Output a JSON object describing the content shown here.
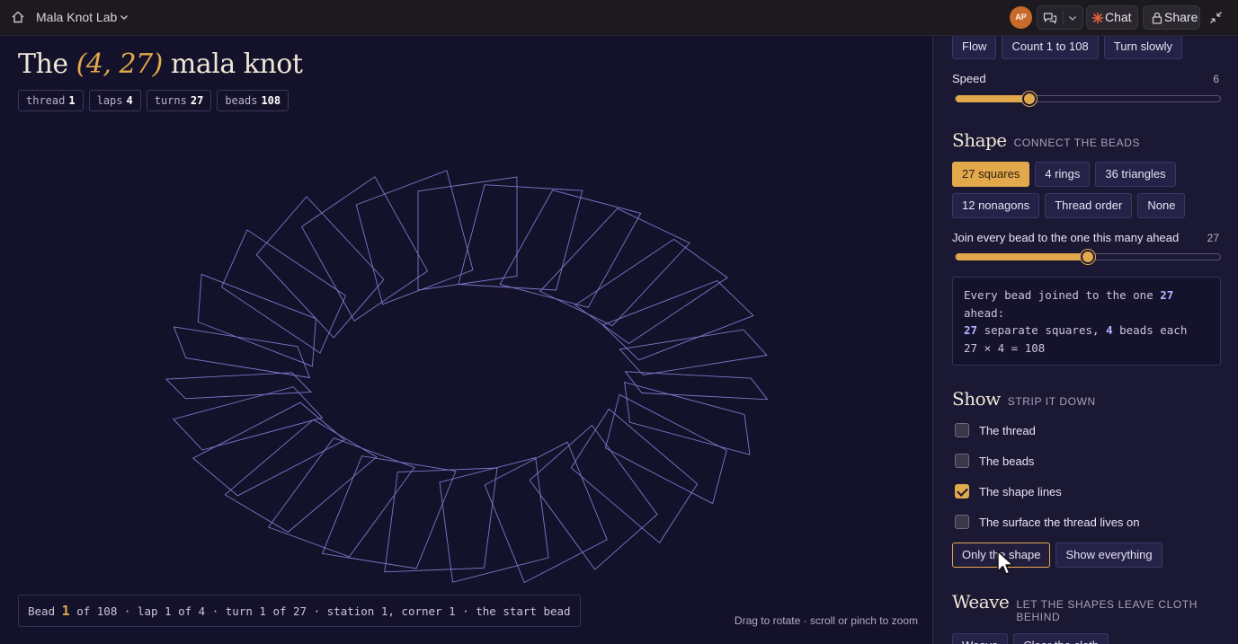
{
  "topbar": {
    "app_title": "Mala Knot Lab",
    "avatar_initials": "AP",
    "chat_label": "Chat",
    "share_label": "Share",
    "icons": [
      "home-icon",
      "chevron-down-icon",
      "conversations-icon",
      "chat-spark-icon",
      "lock-icon",
      "collapse-icon"
    ]
  },
  "header": {
    "title_prefix": "The ",
    "title_highlight": "(4, 27)",
    "title_suffix": " mala knot",
    "chips": [
      {
        "label": "thread",
        "value": "1"
      },
      {
        "label": "laps",
        "value": "4"
      },
      {
        "label": "turns",
        "value": "27"
      },
      {
        "label": "beads",
        "value": "108"
      }
    ]
  },
  "status": {
    "before": "Bead ",
    "bead": "1",
    "after": " of 108 · lap 1 of 4 · turn 1 of 27 · station 1, corner 1 · the start bead"
  },
  "hint": "Drag to rotate · scroll or pinch to zoom",
  "motion": {
    "buttons": [
      "Flow",
      "Count 1 to 108",
      "Turn slowly"
    ],
    "speed_label": "Speed",
    "speed_value": "6",
    "speed_fraction": 0.28
  },
  "shape": {
    "heading": "Shape",
    "subheading": "CONNECT THE BEADS",
    "buttons_row1": [
      "27 squares",
      "4 rings",
      "36 triangles"
    ],
    "buttons_row2": [
      "12 nonagons",
      "Thread order",
      "None"
    ],
    "active_button": "27 squares",
    "join_label": "Join every bead to the one this many ahead",
    "join_value": "27",
    "join_fraction": 0.5,
    "info": {
      "line1_pre": "Every bead joined to the one ",
      "line1_num": "27",
      "line2": "ahead:",
      "line3_num1": "27",
      "line3_mid": " separate squares, ",
      "line3_num2": "4",
      "line3_post": " beads each",
      "line4": "27 × 4 = 108"
    }
  },
  "show": {
    "heading": "Show",
    "subheading": "STRIP IT DOWN",
    "options": [
      {
        "label": "The thread",
        "checked": false
      },
      {
        "label": "The beads",
        "checked": false
      },
      {
        "label": "The shape lines",
        "checked": true
      },
      {
        "label": "The surface the thread lives on",
        "checked": false
      }
    ],
    "only_button": "Only the shape",
    "all_button": "Show everything"
  },
  "weave": {
    "heading": "Weave",
    "subheading": "LET THE SHAPES LEAVE CLOTH BEHIND",
    "buttons": [
      "Weave",
      "Clear the cloth"
    ]
  },
  "colors": {
    "accent": "#e2a84c",
    "background": "#14112a",
    "panel": "#1b1834",
    "knot_stroke": "#7b78c9",
    "highlight_number": "#b9b3ff"
  },
  "knot": {
    "squares": 27,
    "laps": 4
  }
}
